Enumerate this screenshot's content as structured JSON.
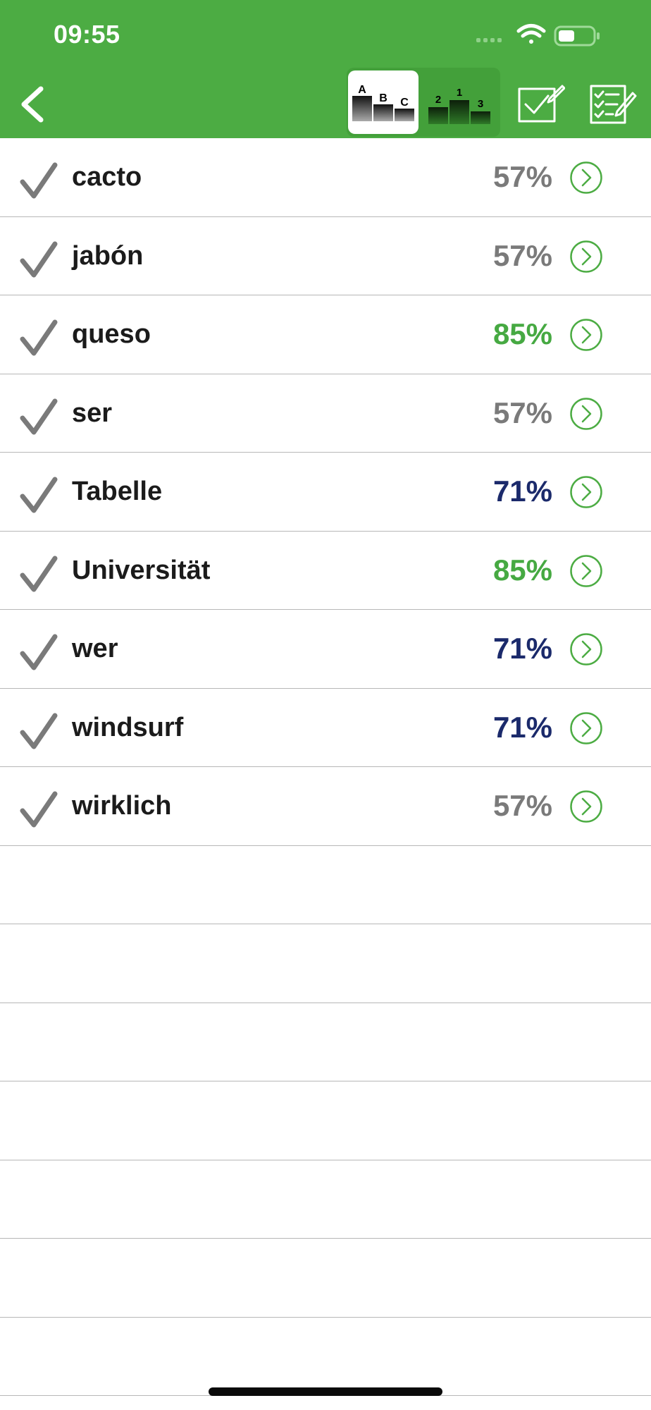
{
  "status_bar": {
    "time": "09:55"
  },
  "colors": {
    "header_bg": "#4CAC43",
    "pct_gray": "#7A7A7A",
    "pct_green": "#46A942",
    "pct_navy": "#1B2A6B",
    "chevron_green": "#4CAC43"
  },
  "toolbar": {
    "sort_alpha_labels": [
      "A",
      "B",
      "C"
    ],
    "sort_rank_labels": [
      "2",
      "1",
      "3"
    ]
  },
  "icons": {
    "back": "chevron-left-icon",
    "sort_alpha": "podium-abc-icon",
    "sort_rank": "podium-ranking-icon",
    "edit": "edit-checkbox-icon",
    "checklist": "checklist-edit-icon",
    "row_check": "checkmark-icon",
    "row_go": "chevron-right-circle-icon"
  },
  "words": [
    {
      "word": "cacto",
      "percent": "57%",
      "color": "#7A7A7A"
    },
    {
      "word": "jabón",
      "percent": "57%",
      "color": "#7A7A7A"
    },
    {
      "word": "queso",
      "percent": "85%",
      "color": "#46A942"
    },
    {
      "word": "ser",
      "percent": "57%",
      "color": "#7A7A7A"
    },
    {
      "word": "Tabelle",
      "percent": "71%",
      "color": "#1B2A6B"
    },
    {
      "word": "Universität",
      "percent": "85%",
      "color": "#46A942"
    },
    {
      "word": "wer",
      "percent": "71%",
      "color": "#1B2A6B"
    },
    {
      "word": "windsurf",
      "percent": "71%",
      "color": "#1B2A6B"
    },
    {
      "word": "wirklich",
      "percent": "57%",
      "color": "#7A7A7A"
    }
  ],
  "empty_rows": 7
}
